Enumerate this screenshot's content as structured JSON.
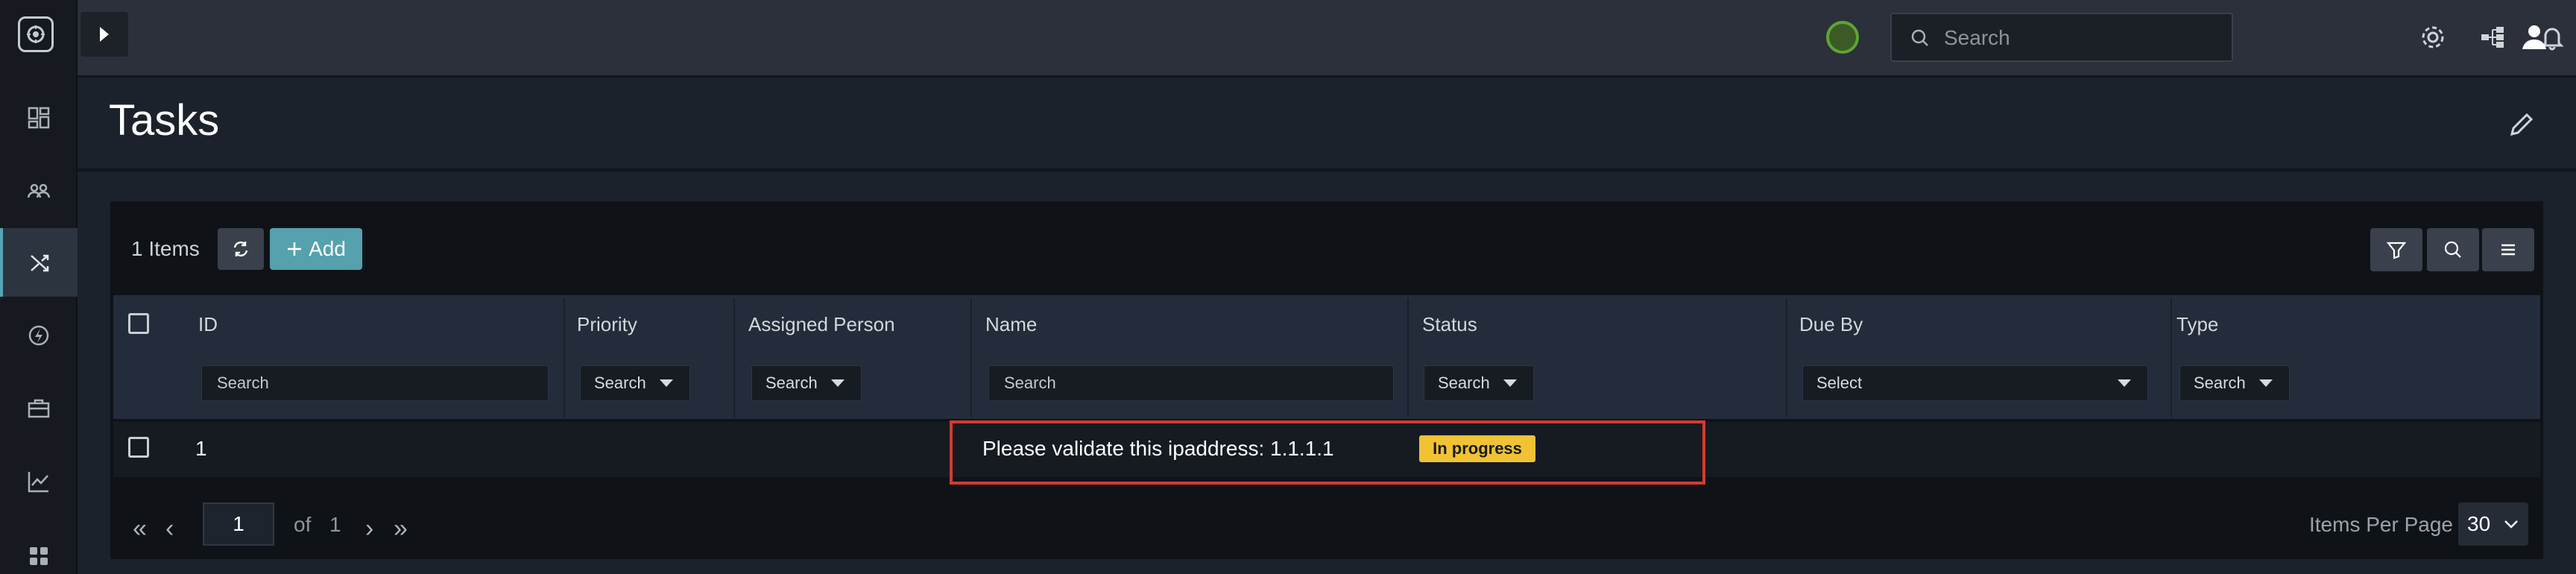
{
  "topbar": {
    "search_placeholder": "Search"
  },
  "page": {
    "title": "Tasks"
  },
  "toolbar": {
    "items_count": "1 Items",
    "add_label": "Add"
  },
  "table": {
    "columns": [
      "ID",
      "Priority",
      "Assigned Person",
      "Name",
      "Status",
      "Due By",
      "Type"
    ],
    "filters": {
      "id": "Search",
      "priority": "Search",
      "assigned": "Search",
      "name": "Search",
      "status": "Search",
      "due_by": "Select",
      "type": "Search"
    },
    "rows": [
      {
        "id": "1",
        "name": "Please validate this ipaddress: 1.1.1.1",
        "status": "In progress"
      }
    ]
  },
  "pagination": {
    "current_page": "1",
    "of_label": "of",
    "total_pages": "1",
    "items_per_page_label": "Items Per Page",
    "items_per_page": "30"
  },
  "colors": {
    "accent": "#55a1ae",
    "status_in_progress": "#f1c232",
    "highlight": "#d63b2b"
  }
}
